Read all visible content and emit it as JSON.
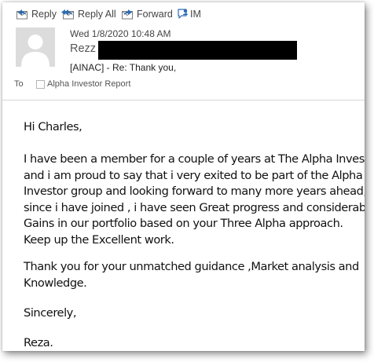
{
  "toolbar": {
    "reply_label": "Reply",
    "reply_all_label": "Reply All",
    "forward_label": "Forward",
    "im_label": "IM"
  },
  "header": {
    "date": "Wed 1/8/2020 10:48 AM",
    "sender_visible": "Rezz",
    "subject": "[AINAC] - Re: Thank you,",
    "to_label": "To",
    "recipient": "Alpha Investor Report"
  },
  "body": {
    "greeting": "Hi Charles,",
    "paragraph1": [
      "I have been a member for a couple of years at The Alpha Investor",
      "and i am proud to say that i very exited to be part of the Alpha",
      "Investor group and looking forward to many more years ahead,",
      "since i have joined , i have seen Great progress and considerable",
      "Gains in our portfolio based on your Three Alpha approach.",
      "Keep up the Excellent work."
    ],
    "paragraph2": [
      "Thank you for your unmatched guidance ,Market analysis and",
      "Knowledge."
    ],
    "closing": "Sincerely,",
    "signature": "Reza."
  },
  "colors": {
    "icon_blue": "#2b6cb5",
    "icon_grey": "#7a7a7a",
    "redaction": "#000000",
    "avatar_bg": "#dcdcdc"
  },
  "icons": {
    "reply": "reply-icon",
    "reply_all": "reply-all-icon",
    "forward": "forward-icon",
    "im": "instant-message-icon",
    "avatar": "person-silhouette-icon"
  }
}
